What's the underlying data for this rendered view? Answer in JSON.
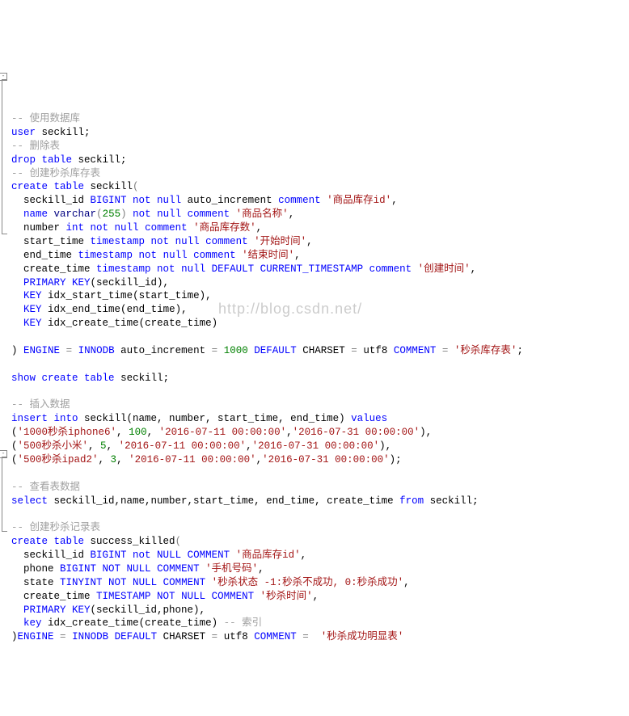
{
  "watermark": "http://blog.csdn.net/",
  "comments": {
    "use_db": "-- 使用数据库",
    "drop_table": "-- 删除表",
    "create_seckill_stock": "-- 创建秒杀库存表",
    "insert_data": "-- 插入数据",
    "select_data": "-- 查看表数据",
    "create_seckill_log": "-- 创建秒杀记录表",
    "index_note": "-- 索引"
  },
  "stmts": {
    "use_db_1": "user",
    "use_db_2": "seckill;",
    "drop_1": "drop table",
    "drop_2": "seckill;",
    "create_1": "create table",
    "create_2": "seckill",
    "col_seckill_id_1": "seckill_id",
    "col_seckill_id_2": "BIGINT not null",
    "col_seckill_id_3": "auto_increment",
    "col_seckill_id_4": "comment",
    "col_seckill_id_5": "'商品库存id'",
    "col_name_1": "name",
    "col_name_2": "varchar",
    "col_name_3": "255",
    "col_name_4": "not null comment",
    "col_name_5": "'商品名称'",
    "col_number_1": "number",
    "col_number_2": "int not null comment",
    "col_number_3": "'商品库存数'",
    "col_start_1": "start_time",
    "col_start_2": "timestamp not null comment",
    "col_start_3": "'开始时间'",
    "col_end_1": "end_time",
    "col_end_2": "timestamp not null comment",
    "col_end_3": "'结束时间'",
    "col_create_1": "create_time",
    "col_create_2": "timestamp not null DEFAULT CURRENT_TIMESTAMP comment",
    "col_create_3": "'创建时间'",
    "pk_1": "PRIMARY KEY",
    "pk_2": "(seckill_id),",
    "key1_1": "KEY",
    "key1_2": "idx_start_time(start_time),",
    "key2_1": "KEY",
    "key2_2": "idx_end_time(end_time),",
    "key3_1": "KEY",
    "key3_2": "idx_create_time(create_time)",
    "eng_1": ")",
    "eng_2": "ENGINE",
    "eng_3": "=",
    "eng_4": "INNODB",
    "eng_5": "auto_increment",
    "eng_6": "=",
    "eng_7": "1000",
    "eng_8": "DEFAULT",
    "eng_9": "CHARSET",
    "eng_10": "=",
    "eng_11": "utf8",
    "eng_12": "COMMENT",
    "eng_13": "=",
    "eng_14": "'秒杀库存表'",
    "show_1": "show",
    "show_2": "create table",
    "show_3": "seckill;",
    "ins_1": "insert into",
    "ins_2": "seckill(name, number, start_time, end_time)",
    "ins_3": "values",
    "row1_a": "'1000秒杀iphone6'",
    "row1_b": "100",
    "row1_c": "'2016-07-11 00:00:00'",
    "row1_d": "'2016-07-31 00:00:00'",
    "row2_a": "'500秒杀小米'",
    "row2_b": "5",
    "row2_c": "'2016-07-11 00:00:00'",
    "row2_d": "'2016-07-31 00:00:00'",
    "row3_a": "'500秒杀ipad2'",
    "row3_b": "3",
    "row3_c": "'2016-07-11 00:00:00'",
    "row3_d": "'2016-07-31 00:00:00'",
    "sel_1": "select",
    "sel_2": "seckill_id,name,number,start_time, end_time, create_time",
    "sel_3": "from",
    "sel_4": "seckill;",
    "ct2_1": "create table",
    "ct2_2": "success_killed",
    "c2_sk_1": "seckill_id",
    "c2_sk_2": "BIGINT not NULL COMMENT",
    "c2_sk_3": "'商品库存id'",
    "c2_ph_1": "phone",
    "c2_ph_2": "BIGINT NOT NULL COMMENT",
    "c2_ph_3": "'手机号码'",
    "c2_st_1": "state",
    "c2_st_2": "TINYINT NOT NULL COMMENT",
    "c2_st_3": "'秒杀状态 -1:秒杀不成功, 0:秒杀成功'",
    "c2_ct_1": "create_time",
    "c2_ct_2": "TIMESTAMP NOT NULL COMMENT",
    "c2_ct_3": "'秒杀时间'",
    "c2_pk_1": "PRIMARY KEY",
    "c2_pk_2": "(seckill_id,phone),",
    "c2_key_1": "key",
    "c2_key_2": "idx_create_time(create_time)",
    "eng2_1": ")",
    "eng2_2": "ENGINE",
    "eng2_3": "=",
    "eng2_4": "INNODB DEFAULT",
    "eng2_5": "CHARSET",
    "eng2_6": "=",
    "eng2_7": "utf8",
    "eng2_8": "COMMENT",
    "eng2_9": "=",
    "eng2_10": "'秒杀成功明显表'"
  }
}
